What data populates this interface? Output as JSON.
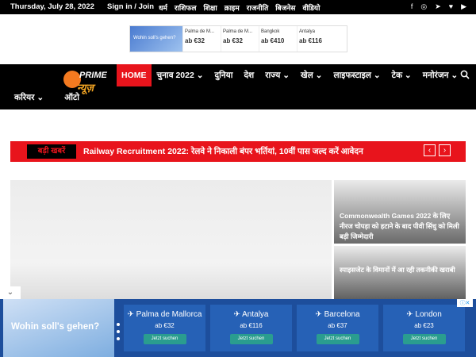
{
  "topbar": {
    "date": "Thursday, July 28, 2022",
    "signin": "Sign in / Join",
    "menu": [
      "धर्म",
      "राशिफल",
      "शिक्षा",
      "क्राइम",
      "राजनीति",
      "बिजनेस",
      "वीडियो"
    ],
    "social": [
      "f",
      "◎",
      "➤",
      "♥",
      "▶"
    ]
  },
  "ad_top": {
    "hero": "Wohin soll's gehen?",
    "deals": [
      {
        "city": "Palma de M...",
        "price": "ab €32"
      },
      {
        "city": "Palma de M...",
        "price": "ab €32"
      },
      {
        "city": "Bangkok",
        "price": "ab €410"
      },
      {
        "city": "Antalya",
        "price": "ab €116"
      }
    ]
  },
  "logo": {
    "prime": "PRIME",
    "news": "न्यूज़"
  },
  "nav": {
    "items": [
      {
        "label": "HOME"
      },
      {
        "label": "चुनाव 2022 ⌄"
      },
      {
        "label": "दुनिया"
      },
      {
        "label": "देश"
      },
      {
        "label": "राज्य ⌄"
      },
      {
        "label": "खेल ⌄"
      },
      {
        "label": "लाइफस्टाइल ⌄"
      },
      {
        "label": "टेक ⌄"
      },
      {
        "label": "मनोरंजन ⌄"
      }
    ],
    "row2": [
      "करियर ⌄",
      "ऑटो"
    ]
  },
  "ticker": {
    "label": "बड़ी खबरें",
    "headline": "Railway Recruitment 2022: रेलवे ने निकाली बंपर भर्तियां, 10वीं पास जल्द करें आवेदन",
    "prev": "‹",
    "next": "›"
  },
  "side": [
    {
      "title": "Commonwealth Games 2022 के लिए नीरज चोपड़ा को हटाने के बाद पीवी सिंधु को मिली बड़ी जिम्मेदारी"
    },
    {
      "title": "स्पाइसजेट के विमानों में आ रही तकनीकी खराबी"
    }
  ],
  "ad_bottom": {
    "hero": "Wohin soll's gehen?",
    "deals": [
      {
        "city": "✈ Palma de Mallorca",
        "price": "ab €32",
        "btn": "Jetzt suchen"
      },
      {
        "city": "✈ Antalya",
        "price": "ab €116",
        "btn": "Jetzt suchen"
      },
      {
        "city": "✈ Barcelona",
        "price": "ab €37",
        "btn": "Jetzt suchen"
      },
      {
        "city": "✈ London",
        "price": "ab €23",
        "btn": "Jetzt suchen"
      }
    ]
  },
  "colors": {
    "accent": "#e8141c",
    "nav_bg": "#000000"
  }
}
